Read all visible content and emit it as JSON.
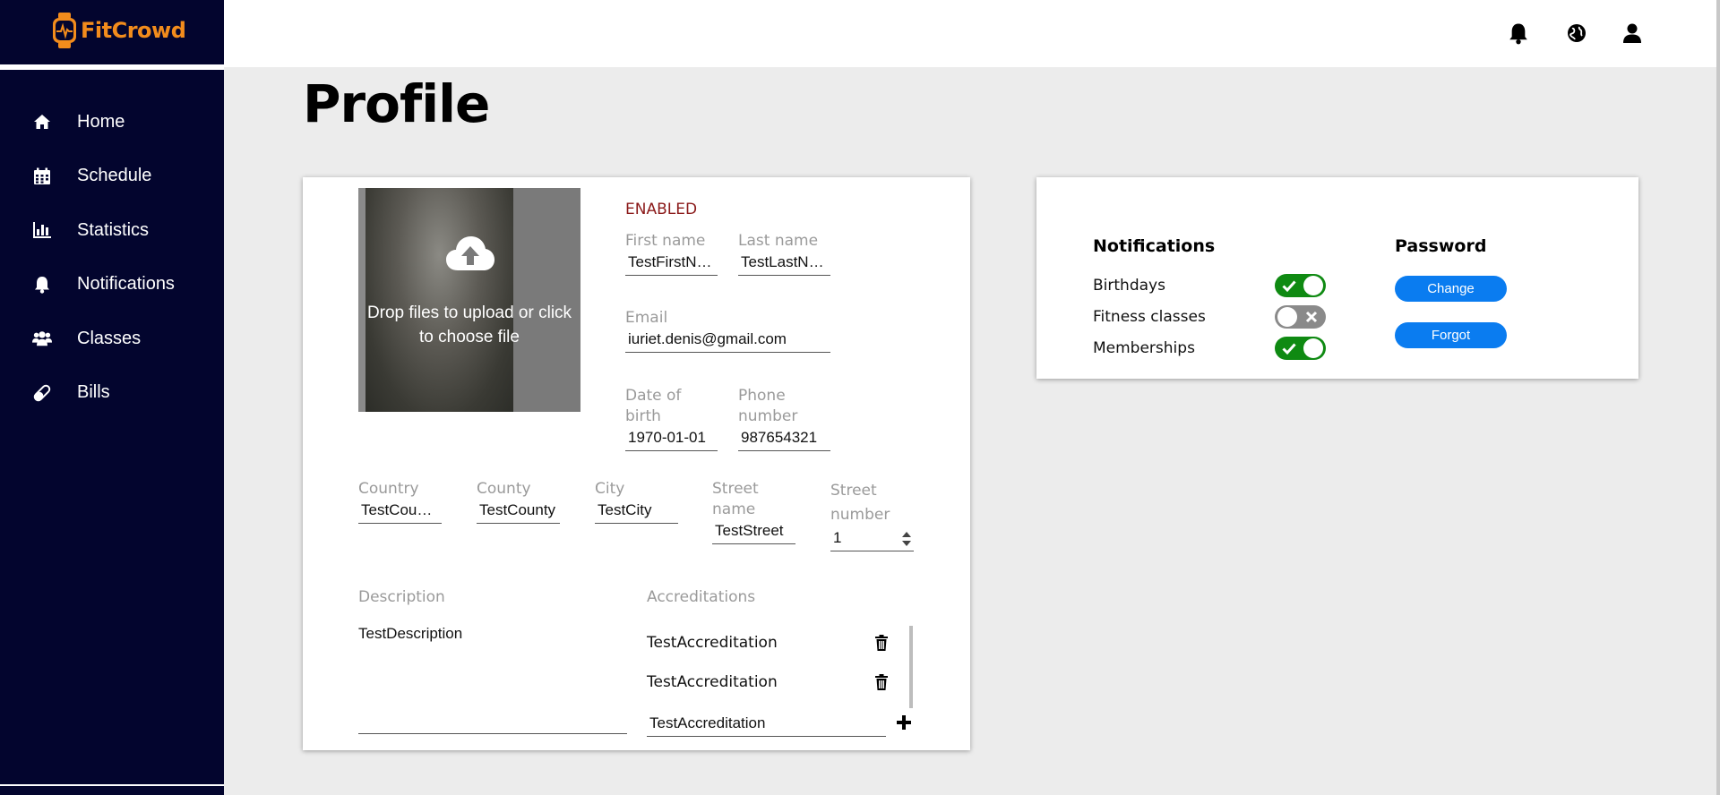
{
  "app": {
    "name": "FitCrowd"
  },
  "sidebar": {
    "items": [
      {
        "label": "Home",
        "icon": "home-icon"
      },
      {
        "label": "Schedule",
        "icon": "calendar-icon"
      },
      {
        "label": "Statistics",
        "icon": "bar-chart-icon"
      },
      {
        "label": "Notifications",
        "icon": "bell-icon"
      },
      {
        "label": "Classes",
        "icon": "users-icon"
      },
      {
        "label": "Bills",
        "icon": "pills-icon"
      }
    ]
  },
  "header": {
    "icons": [
      "bell-icon",
      "globe-icon",
      "user-icon"
    ]
  },
  "page": {
    "title": "Profile"
  },
  "profile": {
    "upload_text": "Drop files to upload or click to choose file",
    "status": "ENABLED",
    "first_name": {
      "label": "First name",
      "value": "TestFirstName"
    },
    "last_name": {
      "label": "Last name",
      "value": "TestLastName"
    },
    "email": {
      "label": "Email",
      "value": "iuriet.denis@gmail.com"
    },
    "dob": {
      "label": "Date of birth",
      "value": "1970-01-01"
    },
    "phone": {
      "label": "Phone number",
      "value": "987654321"
    },
    "country": {
      "label": "Country",
      "value": "TestCountry"
    },
    "county": {
      "label": "County",
      "value": "TestCounty"
    },
    "city": {
      "label": "City",
      "value": "TestCity"
    },
    "street_name": {
      "label": "Street name",
      "value": "TestStreet"
    },
    "street_number": {
      "label": "Street number",
      "value": "1"
    },
    "description": {
      "label": "Description",
      "value": "TestDescription"
    },
    "accreditations": {
      "label": "Accreditations",
      "items": [
        "TestAccreditation",
        "TestAccreditation"
      ],
      "new_value": "TestAccreditation"
    }
  },
  "settings": {
    "notifications": {
      "title": "Notifications",
      "items": [
        {
          "label": "Birthdays",
          "on": true
        },
        {
          "label": "Fitness classes",
          "on": false
        },
        {
          "label": "Memberships",
          "on": true
        }
      ]
    },
    "password": {
      "title": "Password",
      "change_label": "Change",
      "forgot_label": "Forgot"
    }
  },
  "colors": {
    "sidebar_bg": "#03052e",
    "brand_orange": "#f28c1c",
    "toggle_on": "#0f8a12",
    "toggle_off": "#8a8a8a",
    "button_blue": "#0a7cf0",
    "status_red": "#8b1a1a"
  }
}
